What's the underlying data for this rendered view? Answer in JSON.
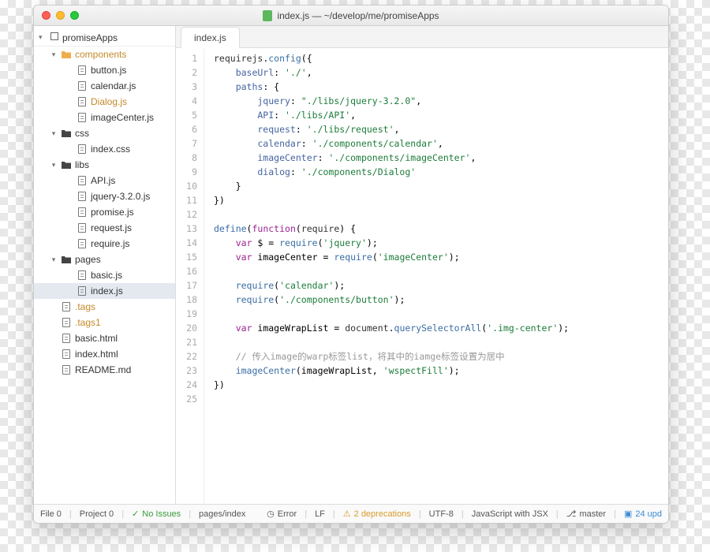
{
  "window": {
    "title": "index.js — ~/develop/me/promiseApps"
  },
  "sidebar": {
    "project": "promiseApps",
    "tree": [
      {
        "label": "components",
        "type": "folder",
        "depth": 1,
        "open": true,
        "orange": true
      },
      {
        "label": "button.js",
        "type": "file",
        "depth": 2
      },
      {
        "label": "calendar.js",
        "type": "file",
        "depth": 2
      },
      {
        "label": "Dialog.js",
        "type": "file",
        "depth": 2,
        "orange": true
      },
      {
        "label": "imageCenter.js",
        "type": "file",
        "depth": 2
      },
      {
        "label": "css",
        "type": "folder",
        "depth": 1,
        "open": true
      },
      {
        "label": "index.css",
        "type": "file",
        "depth": 2
      },
      {
        "label": "libs",
        "type": "folder",
        "depth": 1,
        "open": true
      },
      {
        "label": "API.js",
        "type": "file",
        "depth": 2
      },
      {
        "label": "jquery-3.2.0.js",
        "type": "file",
        "depth": 2
      },
      {
        "label": "promise.js",
        "type": "file",
        "depth": 2
      },
      {
        "label": "request.js",
        "type": "file",
        "depth": 2
      },
      {
        "label": "require.js",
        "type": "file",
        "depth": 2
      },
      {
        "label": "pages",
        "type": "folder",
        "depth": 1,
        "open": true
      },
      {
        "label": "basic.js",
        "type": "file",
        "depth": 2
      },
      {
        "label": "index.js",
        "type": "file",
        "depth": 2,
        "selected": true
      },
      {
        "label": ".tags",
        "type": "file",
        "depth": 1,
        "orange": true
      },
      {
        "label": ".tags1",
        "type": "file",
        "depth": 1,
        "orange": true
      },
      {
        "label": "basic.html",
        "type": "file",
        "depth": 1
      },
      {
        "label": "index.html",
        "type": "file",
        "depth": 1
      },
      {
        "label": "README.md",
        "type": "file",
        "depth": 1
      }
    ]
  },
  "tabs": {
    "active": "index.js"
  },
  "code": {
    "lines": [
      [
        [
          "requirejs",
          "var"
        ],
        [
          ".",
          "p"
        ],
        [
          "config",
          "call"
        ],
        [
          "({",
          "p"
        ]
      ],
      [
        [
          "    baseUrl",
          "prop"
        ],
        [
          ": ",
          "p"
        ],
        [
          "'./'",
          "str"
        ],
        [
          ",",
          "p"
        ]
      ],
      [
        [
          "    paths",
          "prop"
        ],
        [
          ": {",
          "p"
        ]
      ],
      [
        [
          "        jquery",
          "prop"
        ],
        [
          ": ",
          "p"
        ],
        [
          "\"./libs/jquery-3.2.0\"",
          "str"
        ],
        [
          ",",
          "p"
        ]
      ],
      [
        [
          "        API",
          "prop"
        ],
        [
          ": ",
          "p"
        ],
        [
          "'./libs/API'",
          "str"
        ],
        [
          ",",
          "p"
        ]
      ],
      [
        [
          "        request",
          "prop"
        ],
        [
          ": ",
          "p"
        ],
        [
          "'./libs/request'",
          "str"
        ],
        [
          ",",
          "p"
        ]
      ],
      [
        [
          "        calendar",
          "prop"
        ],
        [
          ": ",
          "p"
        ],
        [
          "'./components/calendar'",
          "str"
        ],
        [
          ",",
          "p"
        ]
      ],
      [
        [
          "        imageCenter",
          "prop"
        ],
        [
          ": ",
          "p"
        ],
        [
          "'./components/imageCenter'",
          "str"
        ],
        [
          ",",
          "p"
        ]
      ],
      [
        [
          "        dialog",
          "prop"
        ],
        [
          ": ",
          "p"
        ],
        [
          "'./components/Dialog'",
          "str"
        ]
      ],
      [
        [
          "    }",
          "p"
        ]
      ],
      [
        [
          "})",
          "p"
        ]
      ],
      [],
      [
        [
          "define",
          "call"
        ],
        [
          "(",
          "p"
        ],
        [
          "function",
          "kw"
        ],
        [
          "(",
          "p"
        ],
        [
          "require",
          "var"
        ],
        [
          ") {",
          "p"
        ]
      ],
      [
        [
          "    ",
          "p"
        ],
        [
          "var",
          "kw"
        ],
        [
          " $ = ",
          "p"
        ],
        [
          "require",
          "call"
        ],
        [
          "(",
          "p"
        ],
        [
          "'jquery'",
          "str"
        ],
        [
          ");",
          "p"
        ]
      ],
      [
        [
          "    ",
          "p"
        ],
        [
          "var",
          "kw"
        ],
        [
          " imageCenter = ",
          "p"
        ],
        [
          "require",
          "call"
        ],
        [
          "(",
          "p"
        ],
        [
          "'imageCenter'",
          "str"
        ],
        [
          ");",
          "p"
        ]
      ],
      [],
      [
        [
          "    ",
          "p"
        ],
        [
          "require",
          "call"
        ],
        [
          "(",
          "p"
        ],
        [
          "'calendar'",
          "str"
        ],
        [
          ");",
          "p"
        ]
      ],
      [
        [
          "    ",
          "p"
        ],
        [
          "require",
          "call"
        ],
        [
          "(",
          "p"
        ],
        [
          "'./components/button'",
          "str"
        ],
        [
          ");",
          "p"
        ]
      ],
      [],
      [
        [
          "    ",
          "p"
        ],
        [
          "var",
          "kw"
        ],
        [
          " imageWrapList = ",
          "p"
        ],
        [
          "document",
          "var"
        ],
        [
          ".",
          "p"
        ],
        [
          "querySelectorAll",
          "call"
        ],
        [
          "(",
          "p"
        ],
        [
          "'.img-center'",
          "str"
        ],
        [
          ");",
          "p"
        ]
      ],
      [],
      [
        [
          "    ",
          "p"
        ],
        [
          "// 传入image的warp标签list，将其中的iamge标签设置为居中",
          "comment"
        ]
      ],
      [
        [
          "    ",
          "p"
        ],
        [
          "imageCenter",
          "call"
        ],
        [
          "(imageWrapList, ",
          "p"
        ],
        [
          "'wspectFill'",
          "str"
        ],
        [
          ");",
          "p"
        ]
      ],
      [
        [
          "})",
          "p"
        ]
      ],
      []
    ]
  },
  "status": {
    "file_count": "File  0",
    "project_count": "Project  0",
    "issues": "No Issues",
    "path": "pages/index",
    "error": "Error",
    "line_ending": "LF",
    "deprecations": "2 deprecations",
    "encoding": "UTF-8",
    "language": "JavaScript with JSX",
    "branch": "master",
    "updates": "24 upd"
  }
}
